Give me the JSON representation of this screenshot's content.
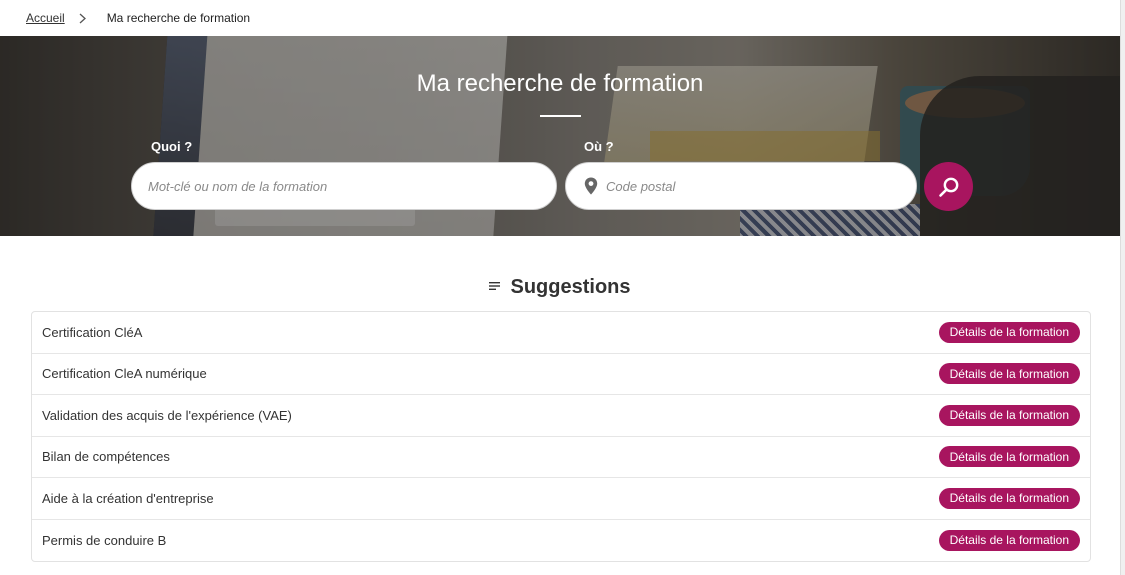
{
  "breadcrumb": {
    "home": "Accueil",
    "current": "Ma recherche de formation"
  },
  "hero": {
    "title": "Ma recherche de formation",
    "what_label": "Quoi ?",
    "what_placeholder": "Mot-clé ou nom de la formation",
    "where_label": "Où ?",
    "where_placeholder": "Code postal",
    "location_icon": "map-pin-icon",
    "search_icon": "search-icon"
  },
  "suggestions": {
    "title": "Suggestions",
    "title_icon": "list-icon",
    "items": [
      {
        "name": "Certification CléA",
        "action": "Détails de la formation"
      },
      {
        "name": "Certification CleA numérique",
        "action": "Détails de la formation"
      },
      {
        "name": "Validation des acquis de l'expérience (VAE)",
        "action": "Détails de la formation"
      },
      {
        "name": "Bilan de compétences",
        "action": "Détails de la formation"
      },
      {
        "name": "Aide à la création d'entreprise",
        "action": "Détails de la formation"
      },
      {
        "name": "Permis de conduire B",
        "action": "Détails de la formation"
      }
    ]
  },
  "colors": {
    "accent": "#a8155f",
    "text": "#333333"
  }
}
